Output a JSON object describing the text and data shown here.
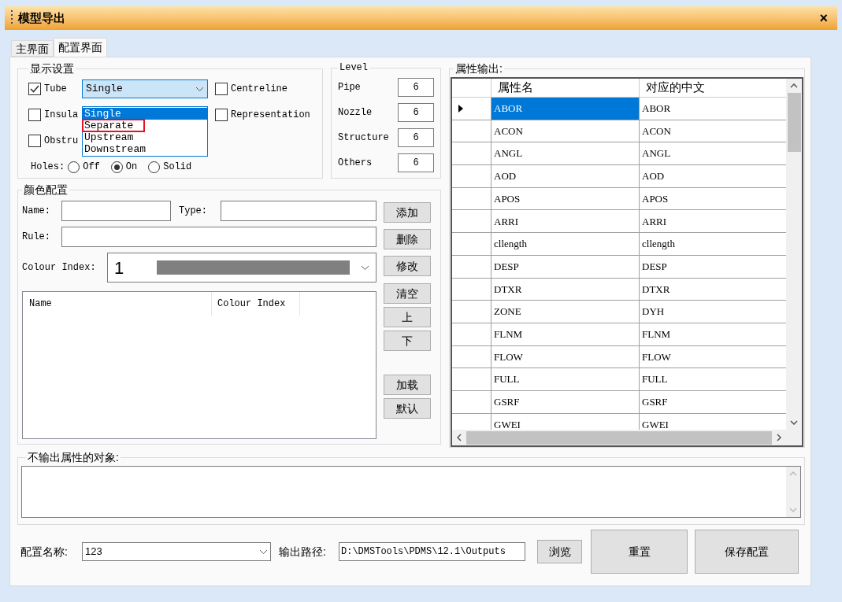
{
  "window": {
    "title": "模型导出",
    "close": "×"
  },
  "tabs": [
    {
      "label": "主界面",
      "selected": false
    },
    {
      "label": "配置界面",
      "selected": true
    }
  ],
  "display_settings": {
    "title": "显示设置",
    "checkboxes": [
      {
        "label": "Tube",
        "checked": true
      },
      {
        "label": "Centreline",
        "checked": false
      },
      {
        "label": "Insula",
        "checked": false
      },
      {
        "label": "Representation",
        "checked": false
      },
      {
        "label": "Obstru",
        "checked": false
      }
    ],
    "tube_mode": {
      "value": "Single",
      "expanded": true,
      "options": [
        {
          "label": "Single",
          "selected": true,
          "highlighted": false
        },
        {
          "label": "Separate",
          "selected": false,
          "highlighted": true
        },
        {
          "label": "Upstream",
          "selected": false,
          "highlighted": false
        },
        {
          "label": "Downstream",
          "selected": false,
          "highlighted": false
        }
      ]
    },
    "holes": {
      "label": "Holes:",
      "options": [
        {
          "label": "Off",
          "selected": false
        },
        {
          "label": "On",
          "selected": true
        },
        {
          "label": "Solid",
          "selected": false
        }
      ]
    }
  },
  "level": {
    "title": "Level",
    "rows": [
      {
        "label": "Pipe",
        "value": "6"
      },
      {
        "label": "Nozzle",
        "value": "6"
      },
      {
        "label": "Structure",
        "value": "6"
      },
      {
        "label": "Others",
        "value": "6"
      }
    ]
  },
  "colour_config": {
    "title": "颜色配置",
    "name_label": "Name:",
    "type_label": "Type:",
    "rule_label": "Rule:",
    "colour_index_label": "Colour Index:",
    "colour_index": "1",
    "buttons": [
      "添加",
      "删除",
      "修改"
    ],
    "list_columns": [
      "Name",
      "Colour Index"
    ],
    "side_buttons": [
      "清空",
      "上",
      "下",
      "加载",
      "默认"
    ]
  },
  "attributes": {
    "title": "属性输出:",
    "columns": [
      "属性名",
      "对应的中文"
    ],
    "rows": [
      {
        "name": "ABOR",
        "chinese": "ABOR",
        "selected": true
      },
      {
        "name": "ACON",
        "chinese": "ACON",
        "selected": false
      },
      {
        "name": "ANGL",
        "chinese": "ANGL",
        "selected": false
      },
      {
        "name": "AOD",
        "chinese": "AOD",
        "selected": false
      },
      {
        "name": "APOS",
        "chinese": "APOS",
        "selected": false
      },
      {
        "name": "ARRI",
        "chinese": "ARRI",
        "selected": false
      },
      {
        "name": "cllength",
        "chinese": "cllength",
        "selected": false
      },
      {
        "name": "DESP",
        "chinese": "DESP",
        "selected": false
      },
      {
        "name": "DTXR",
        "chinese": "DTXR",
        "selected": false
      },
      {
        "name": "ZONE",
        "chinese": "DYH",
        "selected": false
      },
      {
        "name": "FLNM",
        "chinese": "FLNM",
        "selected": false
      },
      {
        "name": "FLOW",
        "chinese": "FLOW",
        "selected": false
      },
      {
        "name": "FULL",
        "chinese": "FULL",
        "selected": false
      },
      {
        "name": "GSRF",
        "chinese": "GSRF",
        "selected": false
      },
      {
        "name": "GWEI",
        "chinese": "GWEI",
        "selected": false
      }
    ]
  },
  "excluded_objects": {
    "title": "不输出属性的对象:"
  },
  "footer": {
    "config_name_label": "配置名称:",
    "config_name": "123",
    "output_path_label": "输出路径:",
    "output_path": "D:\\DMSTools\\PDMS\\12.1\\Outputs",
    "browse": "浏览",
    "reset": "重置",
    "save": "保存配置"
  }
}
